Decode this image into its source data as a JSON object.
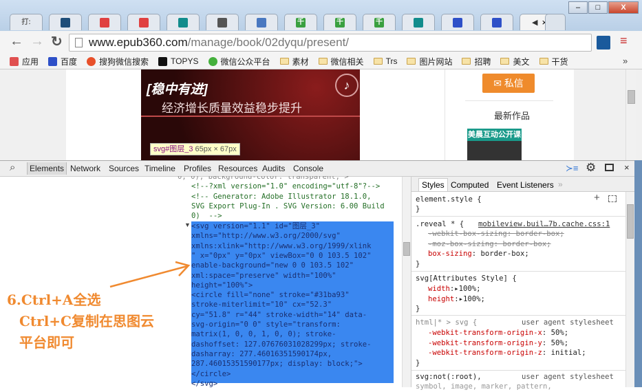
{
  "browser": {
    "tabs": [
      {
        "label": "打:",
        "icon": "text-icon",
        "color": "#bbbbbb"
      },
      {
        "icon": "x-logo-icon",
        "color": "#1f4e79"
      },
      {
        "icon": "red-badge-icon",
        "color": "#e04040"
      },
      {
        "icon": "red-badge-icon",
        "color": "#e04040"
      },
      {
        "icon": "bing-icon",
        "color": "#128c8c"
      },
      {
        "icon": "triangle-icon",
        "color": "#555555"
      },
      {
        "icon": "cloud-icon",
        "color": "#4a78c0"
      },
      {
        "icon": "qian-icon",
        "label": "千",
        "color": "#3aa040"
      },
      {
        "icon": "qian-icon",
        "label": "千",
        "color": "#3aa040"
      },
      {
        "icon": "qian-icon",
        "label": "千",
        "color": "#3aa040"
      },
      {
        "icon": "bing-icon",
        "color": "#128c8c"
      },
      {
        "icon": "baidu-paw-icon",
        "color": "#2e50c8"
      },
      {
        "icon": "baidu-paw-icon",
        "color": "#2e50c8"
      }
    ],
    "active_tab_close": "×",
    "url_host": "www.epub360.com",
    "url_path": "/manage/book/02dyqu/present/",
    "bookmarks": [
      {
        "label": "应用",
        "icon": "apps-grid-icon"
      },
      {
        "label": "百度",
        "icon": "baidu-paw-icon"
      },
      {
        "label": "搜狗微信搜索",
        "icon": "sogou-icon"
      },
      {
        "label": "TOPYS",
        "icon": "topys-icon"
      },
      {
        "label": "微信公众平台",
        "icon": "wechat-icon"
      },
      {
        "label": "素材",
        "icon": "folder-icon"
      },
      {
        "label": "微信相关",
        "icon": "folder-icon"
      },
      {
        "label": "Trs",
        "icon": "folder-icon"
      },
      {
        "label": "图片网站",
        "icon": "folder-icon"
      },
      {
        "label": "招聘",
        "icon": "folder-icon"
      },
      {
        "label": "美文",
        "icon": "folder-icon"
      },
      {
        "label": "干货",
        "icon": "folder-icon"
      }
    ],
    "more_bookmarks": "»"
  },
  "page": {
    "banner_title": "[稳中有进]",
    "banner_subtitle": "经济增长质量效益稳步提升",
    "tooltip_selector": "svg#图层_3",
    "tooltip_size": "65px × 67px",
    "message_button": "私信",
    "latest_works": "最新作品",
    "thumb_caption": "美晨互动公开课"
  },
  "devtools": {
    "tabs": [
      "Elements",
      "Network",
      "Sources",
      "Timeline",
      "Profiles",
      "Resources",
      "Audits",
      "Console"
    ],
    "code_lines": [
      "0, 0); background-color: transparent;\">",
      "<!--?xml version=\"1.0\" encoding=\"utf-8\"?-->",
      "<!-- Generator: Adobe Illustrator 18.1.0,",
      "SVG Export Plug-In . SVG Version: 6.00 Build",
      "0)  -->"
    ],
    "selected_lines": [
      "<svg version=\"1.1\" id=\"图层_3\"",
      "xmlns=\"http://www.w3.org/2000/svg\"",
      "xmlns:xlink=\"http://www.w3.org/1999/xlink",
      "\" x=\"0px\" y=\"0px\" viewBox=\"0 0 103.5 102\"",
      "enable-background=\"new 0 0 103.5 102\"",
      "xml:space=\"preserve\" width=\"100%\"",
      "height=\"100%\">",
      "<circle fill=\"none\" stroke=\"#31ba93\"",
      "stroke-miterlimit=\"10\" cx=\"52.3\"",
      "cy=\"51.8\" r=\"44\" stroke-width=\"14\" data-",
      "svg-origin=\"0 0\" style=\"transform:",
      "matrix(1, 0, 0, 1, 0, 0); stroke-",
      "dashoffset: 127.07676031028299px; stroke-",
      "dasharray: 277.46016351590174px,",
      "287.46015351590177px; display: block;\">",
      "</circle>",
      "</svg>"
    ],
    "styles_tabs": [
      "Styles",
      "Computed",
      "Event Listeners"
    ],
    "styles_more": "»",
    "rules": {
      "element_style": "element.style {",
      "close": "}",
      "reveal_selector": ".reveal * {",
      "reveal_source": "mobileview.buil…7b.cache.css:1",
      "reveal_props": [
        {
          "name": "-webkit-box-sizing",
          "value": "border-box;",
          "struck": true
        },
        {
          "name": "-moz-box-sizing",
          "value": "border-box;",
          "struck": true
        },
        {
          "name": "box-sizing",
          "value": "border-box;",
          "struck": false
        }
      ],
      "attr_selector": "svg[Attributes Style] {",
      "attr_props": [
        {
          "name": "width",
          "value": "100%;"
        },
        {
          "name": "height",
          "value": "100%;"
        }
      ],
      "ua_selector": "html|* > svg {",
      "ua_source": "user agent stylesheet",
      "ua_props": [
        {
          "name": "-webkit-transform-origin-x",
          "value": "50%;"
        },
        {
          "name": "-webkit-transform-origin-y",
          "value": "50%;"
        },
        {
          "name": "-webkit-transform-origin-z",
          "value": "initial;"
        }
      ],
      "last_selector": "svg:not(:root),",
      "last_source": "user agent stylesheet",
      "last_line2": "symbol, image, marker, pattern,"
    }
  },
  "annotation": {
    "line1": "6.Ctrl+A全选",
    "line2": "Ctrl+C复制在思图云",
    "line3": "平台即可"
  }
}
